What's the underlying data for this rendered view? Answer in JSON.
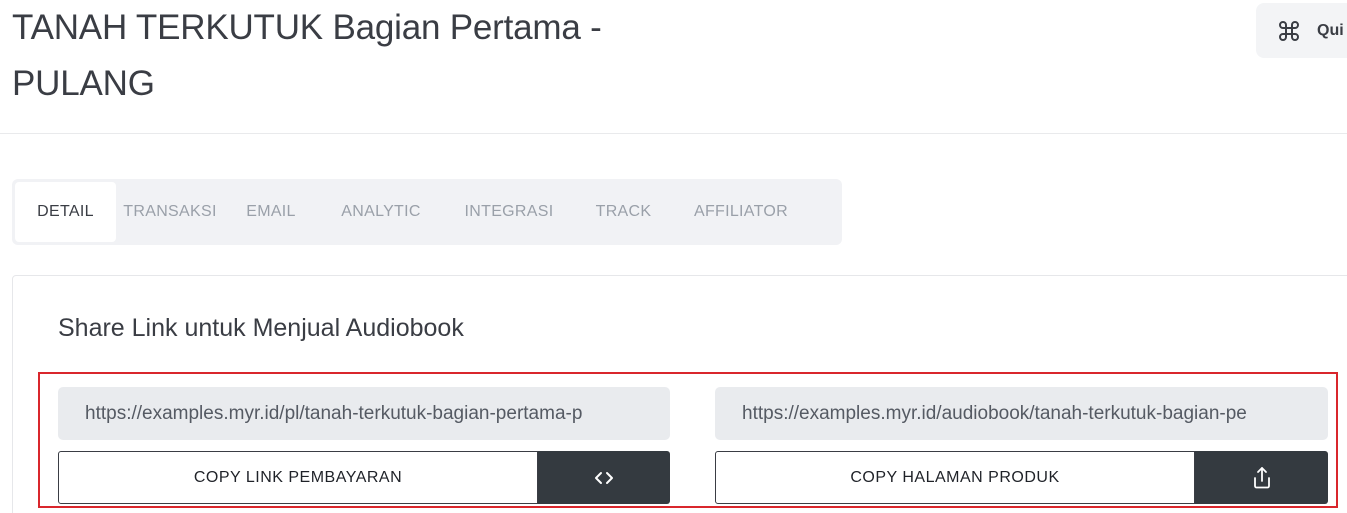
{
  "header": {
    "title": "TANAH TERKUTUK Bagian Pertama - PULANG",
    "quick_button": {
      "label": "Qui",
      "icon": "command-icon"
    }
  },
  "tabs": [
    {
      "label": "DETAIL",
      "active": true
    },
    {
      "label": "TRANSAKSI",
      "active": false
    },
    {
      "label": "EMAIL",
      "active": false
    },
    {
      "label": "ANALYTIC",
      "active": false
    },
    {
      "label": "INTEGRASI",
      "active": false
    },
    {
      "label": "TRACK",
      "active": false
    },
    {
      "label": "AFFILIATOR",
      "active": false
    }
  ],
  "share": {
    "title": "Share Link untuk Menjual Audiobook",
    "payment": {
      "url": "https://examples.myr.id/pl/tanah-terkutuk-bagian-pertama-p",
      "copy_label": "COPY LINK PEMBAYARAN",
      "icon": "code-icon"
    },
    "product": {
      "url": "https://examples.myr.id/audiobook/tanah-terkutuk-bagian-pe",
      "copy_label": "COPY HALAMAN PRODUK",
      "icon": "share-icon"
    }
  },
  "colors": {
    "highlight_border": "#d9262c",
    "dark_button": "#343a40",
    "tab_bar_bg": "#f1f2f5"
  }
}
